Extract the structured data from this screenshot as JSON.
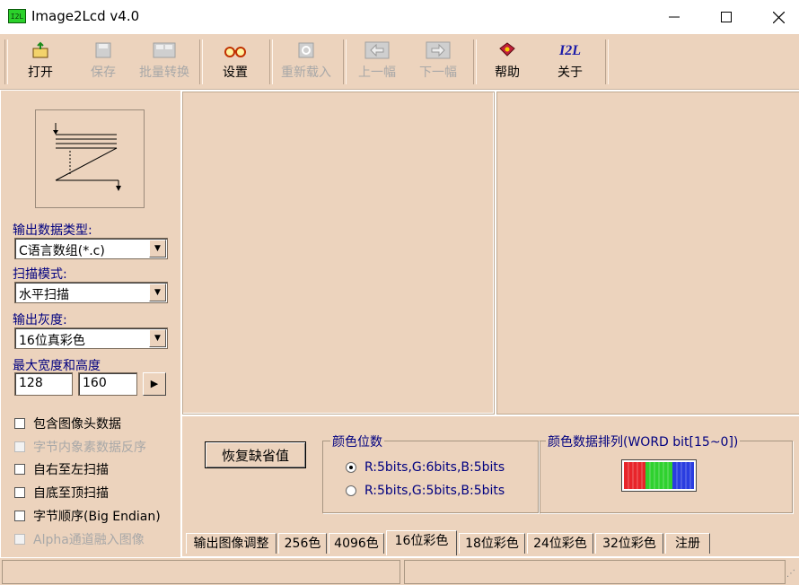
{
  "window": {
    "title": "Image2Lcd v4.0",
    "icon_text": "I2L",
    "controls": {
      "minimize": "—",
      "maximize": "☐",
      "close": "✕"
    }
  },
  "toolbar": {
    "open": "打开",
    "save": "保存",
    "batch": "批量转换",
    "settings": "设置",
    "reload": "重新载入",
    "prev": "上一幅",
    "next": "下一幅",
    "help": "帮助",
    "about": "关于",
    "about_icon": "I2L"
  },
  "left": {
    "output_type_label": "输出数据类型:",
    "output_type_value": "C语言数组(*.c)",
    "scan_mode_label": "扫描模式:",
    "scan_mode_value": "水平扫描",
    "gray_label": "输出灰度:",
    "gray_value": "16位真彩色",
    "max_size_label": "最大宽度和高度",
    "width_value": "128",
    "height_value": "160",
    "checkboxes": [
      {
        "label": "包含图像头数据",
        "enabled": true
      },
      {
        "label": "字节内象素数据反序",
        "enabled": false
      },
      {
        "label": "自右至左扫描",
        "enabled": true
      },
      {
        "label": "自底至顶扫描",
        "enabled": true
      },
      {
        "label": "字节顺序(Big Endian)",
        "enabled": true
      },
      {
        "label": "Alpha通道融入图像",
        "enabled": false
      }
    ]
  },
  "settings": {
    "restore_button": "恢复缺省值",
    "color_bits_title": "颜色位数",
    "radio_1": "R:5bits,G:6bits,B:5bits",
    "radio_2": "R:5bits,G:5bits,B:5bits",
    "arrangement_title": "颜色数据排列(WORD bit[15~0])"
  },
  "tabs": [
    "输出图像调整",
    "256色",
    "4096色",
    "16位彩色",
    "18位彩色",
    "24位彩色",
    "32位彩色",
    "注册"
  ],
  "active_tab": "16位彩色",
  "colors": {
    "panel": "#ecd3bd",
    "red": "#e8242a",
    "green": "#2fd12f",
    "blue": "#2a3de0",
    "label": "#000080"
  }
}
